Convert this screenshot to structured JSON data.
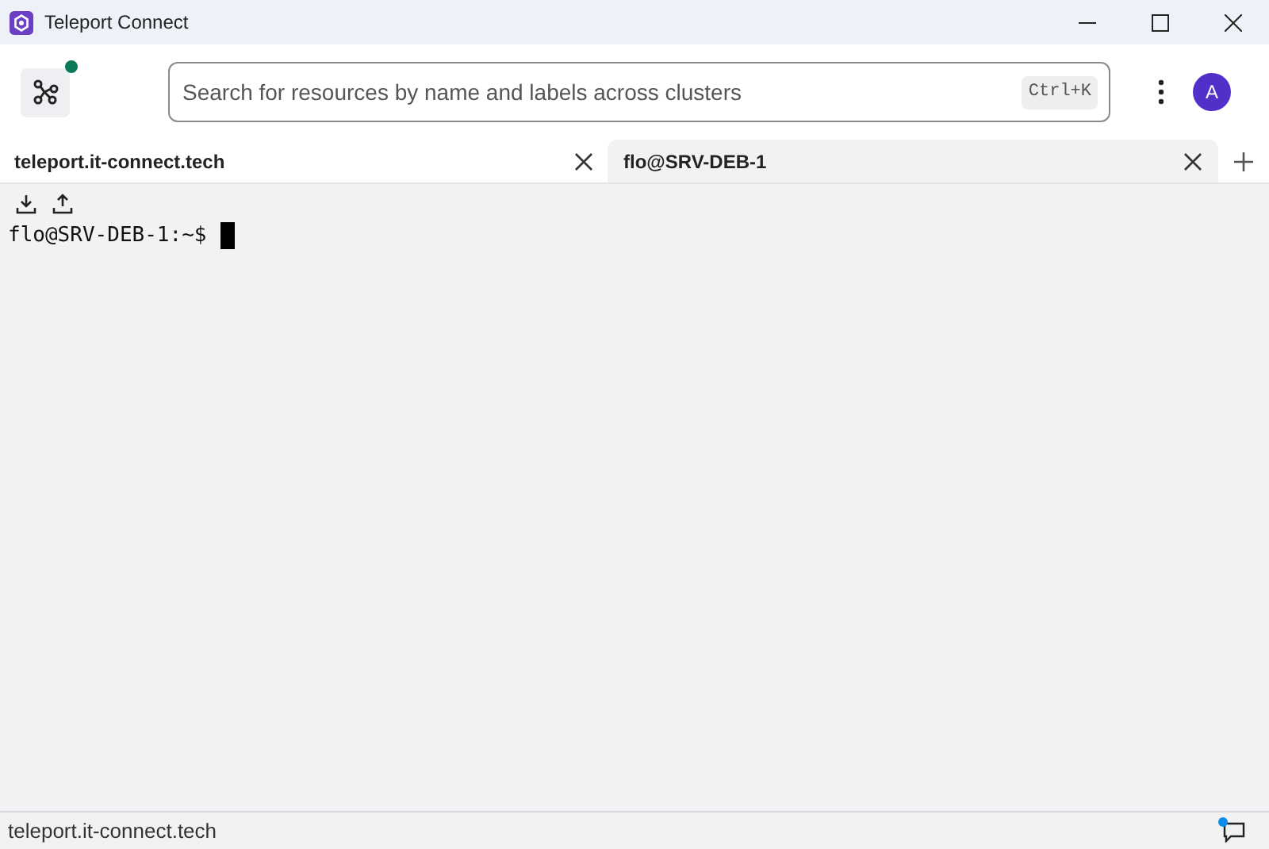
{
  "window": {
    "title": "Teleport Connect"
  },
  "connections": {
    "online": true
  },
  "search": {
    "placeholder": "Search for resources by name and labels across clusters",
    "shortcut": "Ctrl+K"
  },
  "user": {
    "initial": "A"
  },
  "tabs": [
    {
      "label": "teleport.it-connect.tech",
      "selected": false
    },
    {
      "label": "flo@SRV-DEB-1",
      "selected": true
    }
  ],
  "terminal": {
    "prompt": "flo@SRV-DEB-1:~$"
  },
  "status_bar": {
    "text": "teleport.it-connect.tech",
    "notification": true
  }
}
